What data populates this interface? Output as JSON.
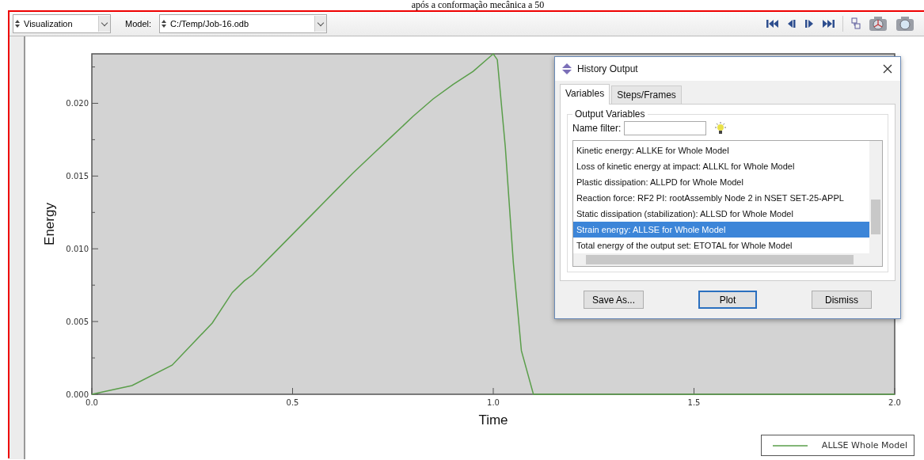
{
  "caption": "após a conformação mecânica a 50",
  "toolbar": {
    "module": {
      "value": "Visualization"
    },
    "model_label": "Model:",
    "model": {
      "value": "C:/Temp/Job-16.odb"
    }
  },
  "viewport": {
    "chart_data": {
      "type": "line",
      "xlabel": "Time",
      "ylabel": "Energy",
      "x": [
        0,
        0.1,
        0.2,
        0.3,
        0.35,
        0.38,
        0.4,
        0.45,
        0.5,
        0.55,
        0.6,
        0.65,
        0.7,
        0.75,
        0.8,
        0.85,
        0.9,
        0.95,
        1.0,
        1.01,
        1.03,
        1.05,
        1.07,
        1.1,
        1.5,
        2.0
      ],
      "series": [
        {
          "name": "ALLSE Whole Model",
          "color": "#5a9e4a",
          "values": [
            0,
            0.0006,
            0.002,
            0.0049,
            0.007,
            0.0078,
            0.0082,
            0.0096,
            0.011,
            0.0124,
            0.0138,
            0.0152,
            0.0165,
            0.0178,
            0.0191,
            0.0203,
            0.0213,
            0.0222,
            0.0234,
            0.023,
            0.017,
            0.009,
            0.003,
            0,
            0,
            0
          ]
        }
      ],
      "xlim": [
        0,
        2
      ],
      "ylim": [
        0,
        0.0234
      ],
      "xticks": [
        {
          "value": 0,
          "label": "0.0"
        },
        {
          "value": 0.5,
          "label": "0.5"
        },
        {
          "value": 1,
          "label": "1.0"
        },
        {
          "value": 1.5,
          "label": "1.5"
        },
        {
          "value": 2,
          "label": "2.0"
        }
      ],
      "yticks": [
        {
          "value": 0,
          "label": "0.000"
        },
        {
          "value": 0.005,
          "label": "0.005"
        },
        {
          "value": 0.01,
          "label": "0.010"
        },
        {
          "value": 0.015,
          "label": "0.015"
        },
        {
          "value": 0.02,
          "label": "0.020"
        }
      ]
    }
  },
  "dialog": {
    "title": "History Output",
    "tabs": [
      {
        "label": "Variables",
        "selected": true
      },
      {
        "label": "Steps/Frames",
        "selected": false
      }
    ],
    "group_title": "Output Variables",
    "filter": {
      "label": "Name filter:"
    },
    "variables": [
      {
        "label": "Kinetic energy: ALLKE for Whole Model",
        "selected": false
      },
      {
        "label": "Loss of kinetic energy at impact: ALLKL for Whole Model",
        "selected": false
      },
      {
        "label": "Plastic dissipation: ALLPD for Whole Model",
        "selected": false
      },
      {
        "label": "Reaction force: RF2 PI: rootAssembly Node 2 in NSET SET-25-APPL",
        "selected": false
      },
      {
        "label": "Static dissipation (stabilization): ALLSD for Whole Model",
        "selected": false
      },
      {
        "label": "Strain energy: ALLSE for Whole Model",
        "selected": true
      },
      {
        "label": "Total energy of the output set: ETOTAL for Whole Model",
        "selected": false
      }
    ],
    "buttons": [
      {
        "label": "Save As...",
        "default": false
      },
      {
        "label": "Plot",
        "default": true
      },
      {
        "label": "Dismiss",
        "default": false
      }
    ]
  }
}
